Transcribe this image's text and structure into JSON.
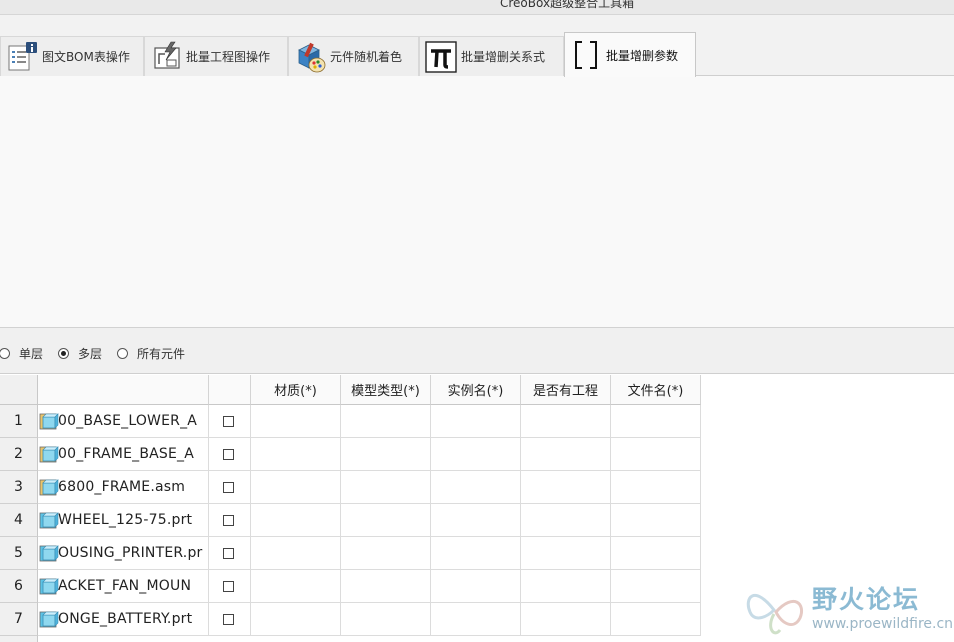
{
  "window": {
    "title": "CreoBox超级整合工具箱"
  },
  "tabs": [
    {
      "label": "图文BOM表操作",
      "icon": "bom-list-icon",
      "active": false
    },
    {
      "label": "批量工程图操作",
      "icon": "drawing-icon",
      "active": false
    },
    {
      "label": "元件随机着色",
      "icon": "color-palette-icon",
      "active": false
    },
    {
      "label": "批量增删关系式",
      "icon": "pi-icon",
      "active": false
    },
    {
      "label": "批量增删参数",
      "icon": "brackets-icon",
      "active": true
    }
  ],
  "scope": {
    "options": [
      {
        "label": "单层",
        "selected": false
      },
      {
        "label": "多层",
        "selected": true
      },
      {
        "label": "所有元件",
        "selected": false
      }
    ]
  },
  "table": {
    "columns": [
      {
        "label": ""
      },
      {
        "label": ""
      },
      {
        "label": "材质(*)"
      },
      {
        "label": "模型类型(*)"
      },
      {
        "label": "实例名(*)"
      },
      {
        "label": "是否有工程"
      },
      {
        "label": "文件名(*)"
      }
    ],
    "rows": [
      {
        "num": "1",
        "name": "00_BASE_LOWER_A",
        "type": "asm"
      },
      {
        "num": "2",
        "name": "00_FRAME_BASE_A",
        "type": "asm"
      },
      {
        "num": "3",
        "name": "6800_FRAME.asm",
        "type": "asm"
      },
      {
        "num": "4",
        "name": "WHEEL_125-75.prt",
        "type": "prt"
      },
      {
        "num": "5",
        "name": "OUSING_PRINTER.pr",
        "type": "prt"
      },
      {
        "num": "6",
        "name": "ACKET_FAN_MOUN",
        "type": "prt"
      },
      {
        "num": "7",
        "name": "ONGE_BATTERY.prt",
        "type": "prt"
      }
    ]
  },
  "watermark": {
    "title": "野火论坛",
    "url": "www.proewildfire.cn"
  },
  "colors": {
    "asm_icon": "#e9c46a",
    "prt_icon": "#5cc3e6",
    "watermark": "#7fb3cf"
  }
}
